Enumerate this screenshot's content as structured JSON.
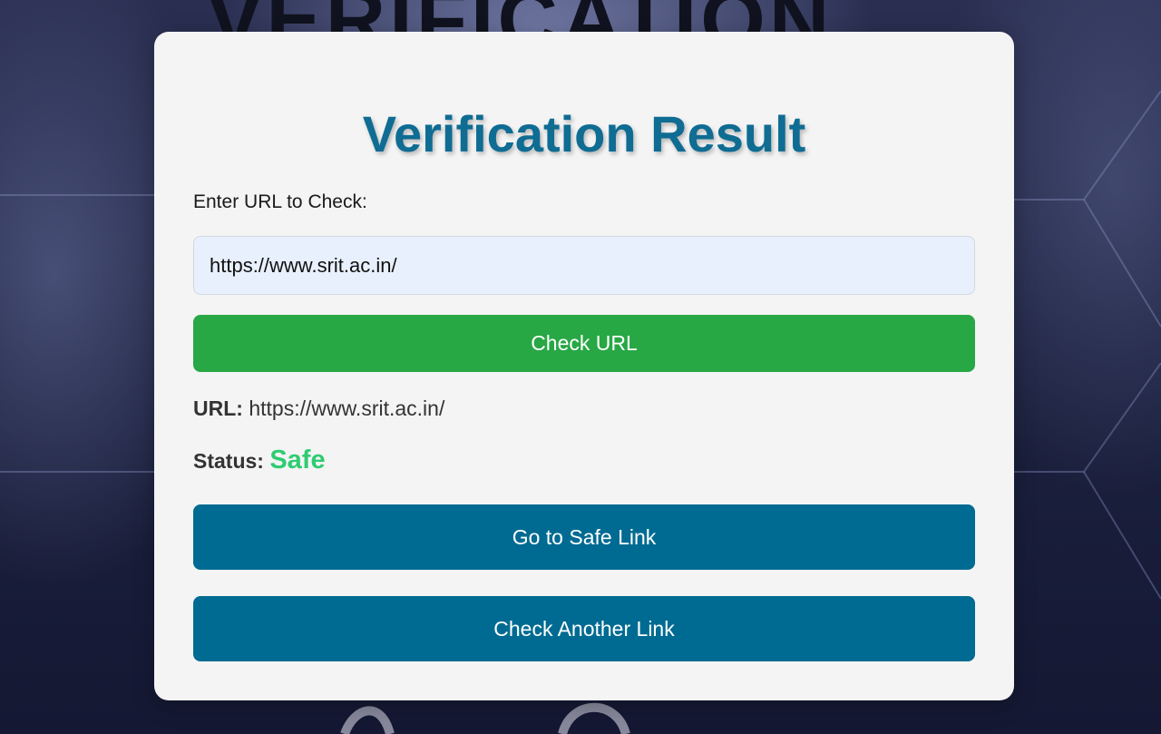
{
  "background": {
    "word": "VERIFICATION"
  },
  "card": {
    "title": "Verification Result",
    "url_label": "Enter URL to Check:",
    "url_input_value": "https://www.srit.ac.in/",
    "check_button_label": "Check URL",
    "result": {
      "url_label": "URL:",
      "url_value": "https://www.srit.ac.in/",
      "status_label": "Status:",
      "status_value": "Safe"
    },
    "go_button_label": "Go to Safe Link",
    "another_button_label": "Check Another Link"
  },
  "colors": {
    "title": "#0f6c93",
    "check_button": "#28a745",
    "action_button": "#006b92",
    "status_safe": "#2ecc71",
    "input_background": "#e8f0fe",
    "card_background": "#f4f4f4"
  }
}
